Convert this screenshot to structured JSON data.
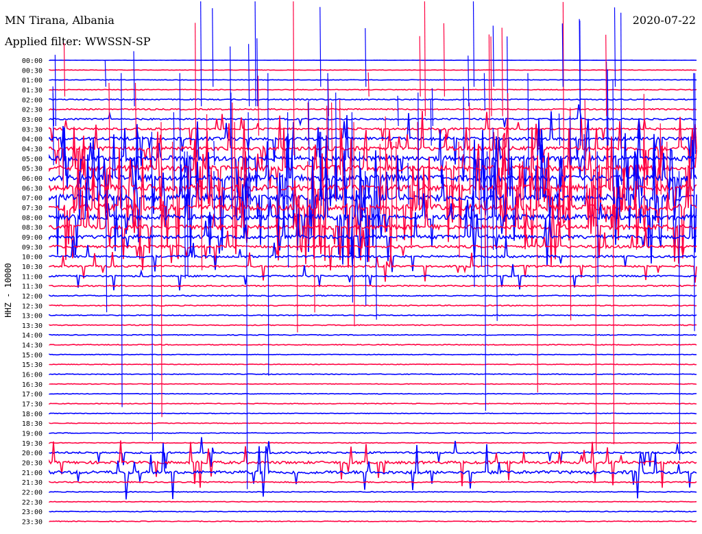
{
  "header": {
    "station": "MN Tirana, Albania",
    "date": "2020-07-22",
    "filter": "Applied filter: WWSSN-SP"
  },
  "chart_data": {
    "type": "line",
    "title": "MN Tirana, Albania",
    "ylabel": "HHZ - 10000",
    "time_labels": [
      "00:00",
      "00:30",
      "01:00",
      "01:30",
      "02:00",
      "02:30",
      "03:00",
      "03:30",
      "04:00",
      "04:30",
      "05:00",
      "05:30",
      "06:00",
      "06:30",
      "07:00",
      "07:30",
      "08:00",
      "08:30",
      "09:00",
      "09:30",
      "10:00",
      "10:30",
      "11:00",
      "11:30",
      "12:00",
      "12:30",
      "13:00",
      "13:30",
      "14:00",
      "14:30",
      "15:00",
      "15:30",
      "16:00",
      "16:30",
      "17:00",
      "17:30",
      "18:00",
      "18:30",
      "19:00",
      "19:30",
      "20:00",
      "20:30",
      "21:00",
      "21:30",
      "22:00",
      "22:30",
      "23:00",
      "23:30"
    ],
    "trace_colors": [
      "#0000ff",
      "#ff0040"
    ],
    "activity_note_levels": [
      0.1,
      0.2,
      0.25,
      0.35,
      0.5,
      0.6,
      0.7,
      0.9,
      1.4,
      1.8,
      2.2,
      2.4,
      2.6,
      2.8,
      2.9,
      2.8,
      2.4,
      2.0,
      1.6,
      1.2,
      1.0,
      0.8,
      0.7,
      0.6,
      0.5,
      0.45,
      0.4,
      0.4,
      0.35,
      0.35,
      0.3,
      0.3,
      0.3,
      0.3,
      0.3,
      0.3,
      0.3,
      0.3,
      0.3,
      0.3,
      0.8,
      1.2,
      1.4,
      0.5,
      0.3,
      0.3,
      0.35,
      0.3
    ]
  }
}
